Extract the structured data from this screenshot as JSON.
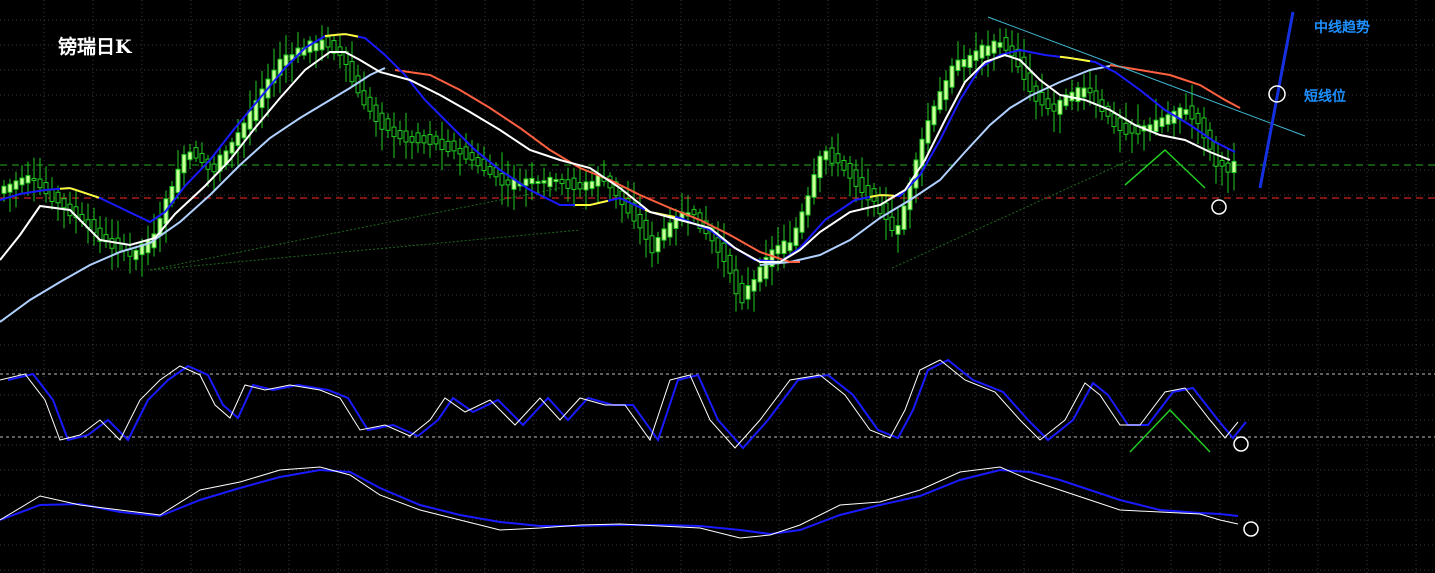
{
  "chart_data": {
    "type": "candlestick",
    "title": "镑瑞日K",
    "annotations": [
      "中线趋势",
      "短线位"
    ],
    "grid": true,
    "grid_style": "dotted",
    "colors": {
      "background": "#000000",
      "candle": "#22cc22",
      "candle_body_up": "#ccff99",
      "ma_fast": "#ffffff",
      "ma_mid": "#1a1aff",
      "ma_mid_highlight": "#ffff33",
      "ma_slow": "#ff6040",
      "ma_long": "#b0d0ff",
      "horizontal_green": "#22aa22",
      "horizontal_red": "#cc2020",
      "trend_line": "#1530e0",
      "channel_line": "#40b8d0",
      "annotation_text": "#1e90ff"
    },
    "panels": [
      {
        "name": "price",
        "lines": [
          "ma_fast",
          "ma_mid",
          "ma_slow",
          "ma_long"
        ]
      },
      {
        "name": "oscillator-1",
        "lines": [
          "white",
          "blue"
        ]
      },
      {
        "name": "oscillator-2",
        "lines": [
          "white",
          "blue"
        ]
      }
    ]
  }
}
